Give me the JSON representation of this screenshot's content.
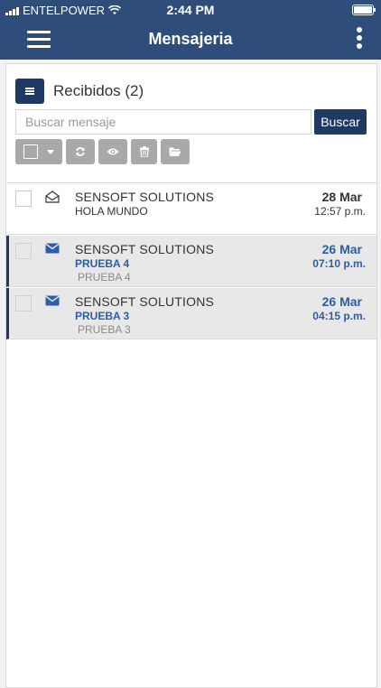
{
  "status_bar": {
    "carrier": "ENTELPOWER",
    "time": "2:44 PM"
  },
  "header": {
    "title": "Mensajeria"
  },
  "inbox": {
    "title": "Recibidos (2)"
  },
  "search": {
    "placeholder": "Buscar mensaje",
    "value": "",
    "button_label": "Buscar"
  },
  "colors": {
    "header_bg": "#2f4d7a",
    "accent": "#1e3963",
    "unread_text": "#2b5ea7",
    "toolbar_button": "#a9a9a9"
  },
  "messages": [
    {
      "sender": "SENSOFT SOLUTIONS",
      "subject": "HOLA MUNDO",
      "preview": "",
      "date": "28 Mar",
      "time": "12:57 p.m.",
      "read": true,
      "icon": "envelope-open-icon"
    },
    {
      "sender": "SENSOFT SOLUTIONS",
      "subject": "PRUEBA 4",
      "preview": "PRUEBA 4",
      "date": "26 Mar",
      "time": "07:10 p.m.",
      "read": false,
      "icon": "envelope-closed-icon"
    },
    {
      "sender": "SENSOFT SOLUTIONS",
      "subject": "PRUEBA 3",
      "preview": "PRUEBA 3",
      "date": "26 Mar",
      "time": "04:15 p.m.",
      "read": false,
      "icon": "envelope-closed-icon"
    }
  ]
}
